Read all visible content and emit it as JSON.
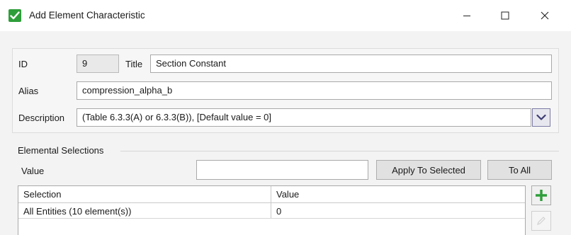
{
  "window": {
    "title": "Add Element Characteristic",
    "icons": {
      "app": "checkbox-check-icon",
      "minimize": "minimize-icon",
      "maximize": "maximize-icon",
      "close": "close-icon"
    }
  },
  "form": {
    "id_label": "ID",
    "id_value": "9",
    "title_label": "Title",
    "title_value": "Section Constant",
    "alias_label": "Alias",
    "alias_value": "compression_alpha_b",
    "description_label": "Description",
    "description_value": "(Table 6.3.3(A) or 6.3.3(B)), [Default value = 0]",
    "description_dropdown_icon": "chevron-down-icon"
  },
  "elemental": {
    "group_title": "Elemental Selections",
    "value_label": "Value",
    "value_input": "",
    "apply_button": "Apply To Selected",
    "to_all_button": "To All",
    "grid": {
      "columns": [
        "Selection",
        "Value"
      ],
      "rows": [
        {
          "selection": "All Entities (10 element(s))",
          "value": "0"
        }
      ]
    },
    "side_buttons": {
      "add": "plus-icon",
      "edit": "pencil-icon"
    }
  },
  "colors": {
    "accent_green": "#2e9e3a",
    "dropdown_border": "#7c7ca6"
  }
}
